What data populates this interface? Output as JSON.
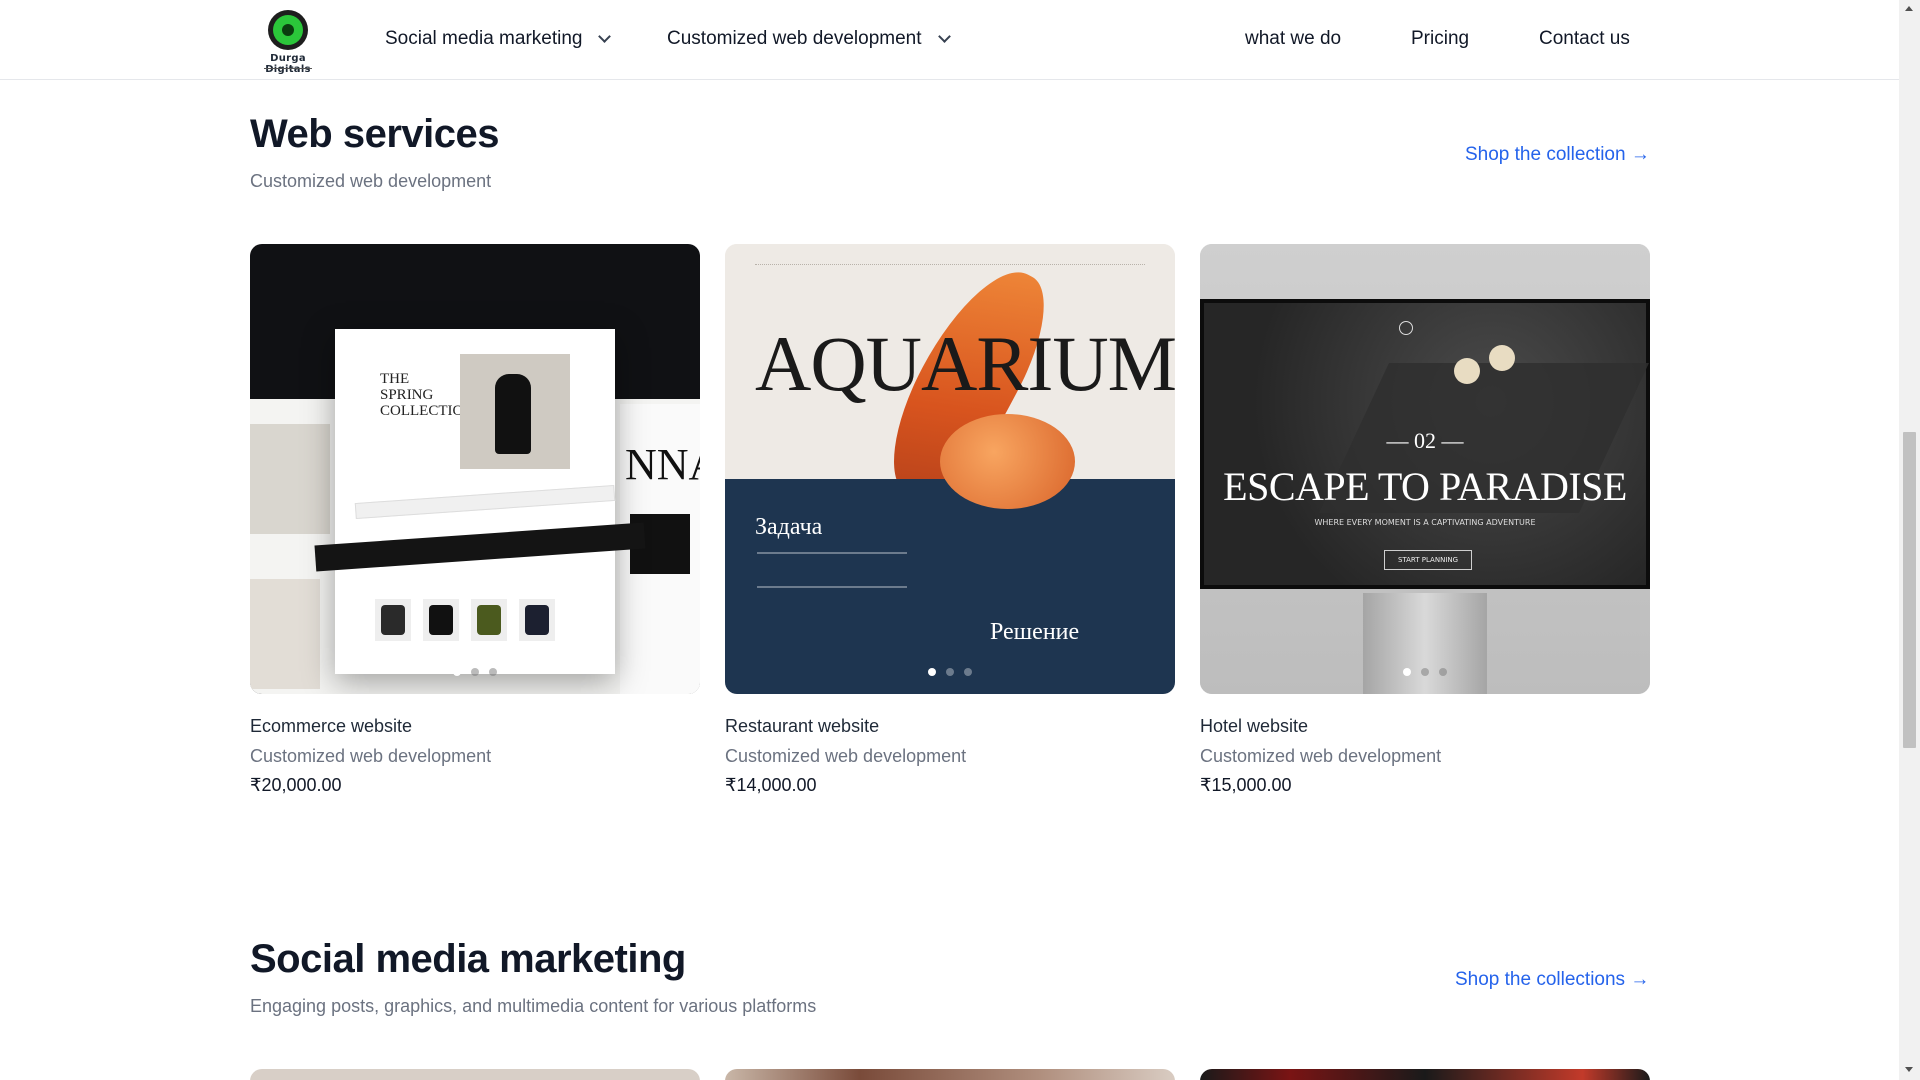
{
  "header": {
    "logo_text": "Durga Digitals",
    "nav": [
      {
        "label": "Social media marketing"
      },
      {
        "label": "Customized web development"
      },
      {
        "label": "what we do"
      },
      {
        "label": "Pricing"
      },
      {
        "label": "Contact us"
      }
    ]
  },
  "web_services": {
    "title": "Web services",
    "subtitle": "Customized web development",
    "link": "Shop the collection →",
    "products": [
      {
        "title": "Ecommerce website",
        "subtitle": "Customized web development",
        "price": "₹20,000.00",
        "image_text": {
          "collection": "THE SPRING COLLECTION",
          "brand": "NNA"
        }
      },
      {
        "title": "Restaurant website",
        "subtitle": "Customized web development",
        "price": "₹14,000.00",
        "image_text": {
          "headline": "AQUARIUM",
          "task": "Задача",
          "solution": "Решение"
        }
      },
      {
        "title": "Hotel website",
        "subtitle": "Customized web development",
        "price": "₹15,000.00",
        "image_text": {
          "number": "— 02 —",
          "headline": "ESCAPE TO PARADISE",
          "tagline": "WHERE EVERY MOMENT IS A CAPTIVATING ADVENTURE",
          "button": "START PLANNING"
        }
      }
    ]
  },
  "social_media": {
    "title": "Social media marketing",
    "subtitle": "Engaging posts, graphics, and multimedia content for various platforms",
    "link": "Shop the collections →"
  },
  "colors": {
    "link": "#2563eb",
    "text": "#111827",
    "muted": "#6b7280",
    "logo_green": "#2bc63a"
  }
}
